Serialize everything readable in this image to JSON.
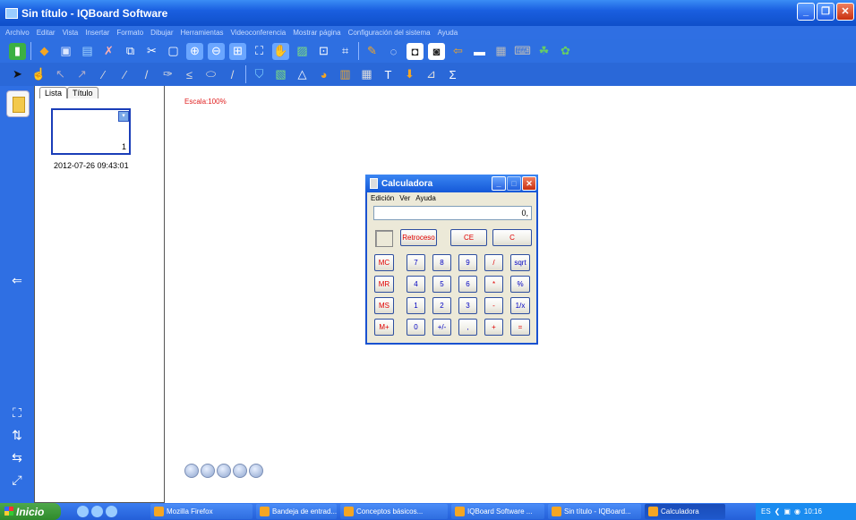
{
  "window": {
    "title": "Sin título - IQBoard Software"
  },
  "menu": [
    "Archivo",
    "Editar",
    "Vista",
    "Insertar",
    "Formato",
    "Dibujar",
    "Herramientas",
    "Videoconferencia",
    "Mostrar página",
    "Configuración del sistema",
    "Ayuda"
  ],
  "panel": {
    "tabs": [
      "Lista",
      "Título"
    ],
    "thumb_number": "1",
    "thumb_date": "2012-07-26 09:43:01"
  },
  "canvas": {
    "zoom_label": "Escala:100%"
  },
  "calculator": {
    "title": "Calculadora",
    "menu": [
      "Edición",
      "Ver",
      "Ayuda"
    ],
    "display": "0,",
    "keys": {
      "backspace": "Retroceso",
      "ce": "CE",
      "c": "C",
      "mc": "MC",
      "mr": "MR",
      "ms": "MS",
      "mplus": "M+",
      "k7": "7",
      "k8": "8",
      "k9": "9",
      "div": "/",
      "sqrt": "sqrt",
      "k4": "4",
      "k5": "5",
      "k6": "6",
      "mul": "*",
      "pct": "%",
      "k1": "1",
      "k2": "2",
      "k3": "3",
      "sub": "-",
      "inv": "1/x",
      "k0": "0",
      "sign": "+/-",
      "dec": ",",
      "add": "+",
      "eq": "="
    }
  },
  "taskbar": {
    "start": "Inicio",
    "tasks": [
      "Mozilla Firefox",
      "Bandeja de entrad...",
      "Conceptos básicos...",
      "IQBoard Software ...",
      "Sin título - IQBoard...",
      "Calculadora"
    ],
    "tray_lang": "ES",
    "clock": "10:16"
  }
}
